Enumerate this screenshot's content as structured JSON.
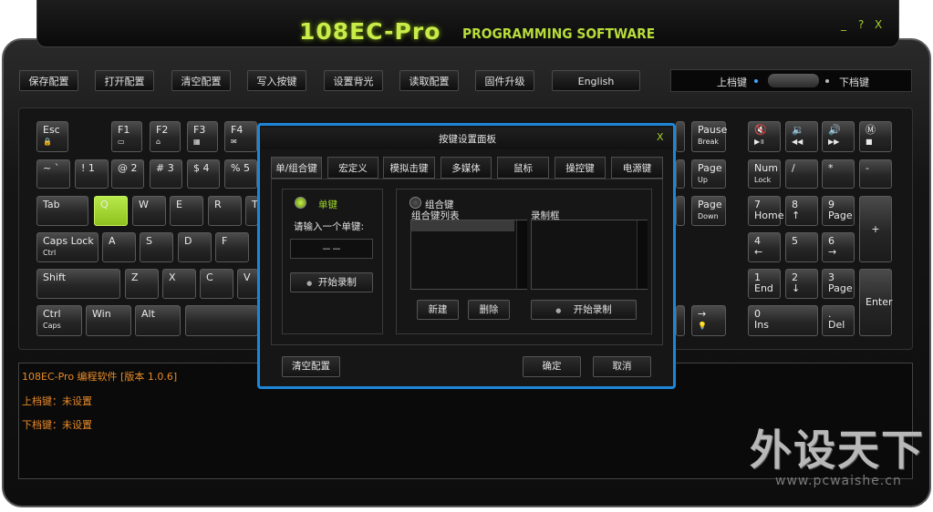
{
  "app": {
    "title": "108EC-Pro",
    "subtitle": "PROGRAMMING SOFTWARE"
  },
  "window_controls": {
    "minimize": "_",
    "help": "?",
    "close": "X"
  },
  "toolbar": {
    "buttons": [
      "保存配置",
      "打开配置",
      "清空配置",
      "写入按键",
      "设置背光",
      "读取配置",
      "固件升级",
      "English"
    ]
  },
  "side": {
    "upper": "上档键",
    "lower": "下档键"
  },
  "keys": {
    "esc": "Esc",
    "f1": "F1",
    "f2": "F2",
    "f3": "F3",
    "f4": "F4",
    "tilde": "~  `",
    "n1": "!  1",
    "n2": "@  2",
    "n3": "#  3",
    "n4": "$  4",
    "n5": "%  5",
    "tab": "Tab",
    "q": "Q",
    "w": "W",
    "e": "E",
    "r": "R",
    "t": "T",
    "caps": "Caps Lock",
    "caps_sub": "Ctrl",
    "a": "A",
    "s": "S",
    "d": "D",
    "f": "F",
    "shift": "Shift",
    "z": "Z",
    "x": "X",
    "c": "C",
    "v": "V",
    "ctrl": "Ctrl",
    "ctrl_sub": "Caps",
    "win": "Win",
    "alt": "Alt",
    "pause": "Pause",
    "pause_sub": "Break",
    "pgup": "Page",
    "pgup_sub": "Up",
    "pgdn": "Page",
    "pgdn_sub": "Down",
    "numlock": "Num",
    "numlock_sub": "Lock",
    "slash": "/",
    "star": "*",
    "minus": "-",
    "n7": "7",
    "n7b": "Home",
    "n8": "8",
    "n9": "9",
    "n9b": "Page",
    "n4k": "4",
    "n5k": "5",
    "n6k": "6",
    "plus": "+",
    "n1k": "1",
    "n1b": "End",
    "n2k": "2",
    "n3k": "3",
    "n3b": "Page",
    "enter": "Enter",
    "n0": "0",
    "n0b": "Ins",
    "dot": ".",
    "dotb": "Del",
    "fn_m": "Ⓜ"
  },
  "dialog": {
    "title": "按键设置面板",
    "close": "X",
    "tabs": [
      "单/组合键",
      "宏定义",
      "模拟击键",
      "多媒体",
      "鼠标",
      "操控键",
      "电源键"
    ],
    "single": "单键",
    "single_prompt": "请输入一个单键:",
    "single_value": "－－",
    "single_record": "开始录制",
    "combo": "组合键",
    "combo_list": "组合键列表",
    "record_box": "录制框",
    "new_btn": "新建",
    "del_btn": "删除",
    "combo_record": "开始录制",
    "clear_btn": "清空配置",
    "ok_btn": "确定",
    "cancel_btn": "取消"
  },
  "log": {
    "lines": [
      "108EC-Pro 编程软件 [版本 1.0.6]",
      "上档键：未设置",
      "下档键：未设置"
    ]
  },
  "watermark": {
    "main": "外设天下",
    "url": "www.pcwaishe.cn"
  },
  "colors": {
    "accent": "#a3cf2a",
    "dialog_border": "#1e86d8",
    "log_text": "#e88a2a"
  }
}
